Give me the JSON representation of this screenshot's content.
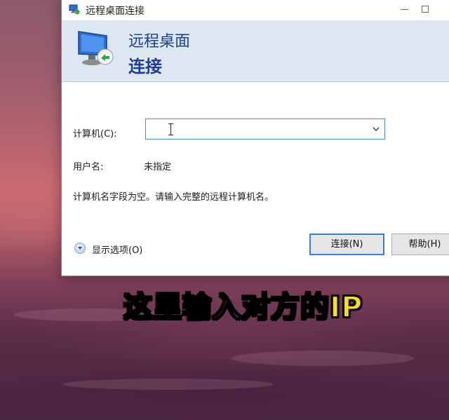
{
  "window": {
    "title": "远程桌面连接"
  },
  "banner": {
    "line1": "远程桌面",
    "line2": "连接"
  },
  "form": {
    "computer_label": "计算机(C):",
    "computer_value": "",
    "user_label": "用户名:",
    "user_value": "未指定",
    "hint": "计算机名字段为空。请输入完整的远程计算机名。"
  },
  "footer": {
    "show_options": "显示选项(O)",
    "connect_button": "连接(N)",
    "help_button": "帮助(H)"
  },
  "caption": {
    "text": "这里输入对方的IP"
  },
  "colors": {
    "banner_text": "#1e3f8f",
    "banner_bg": "#dde7f2",
    "focus_border": "#3c7fd0",
    "caption_fill": "#ffe100"
  }
}
